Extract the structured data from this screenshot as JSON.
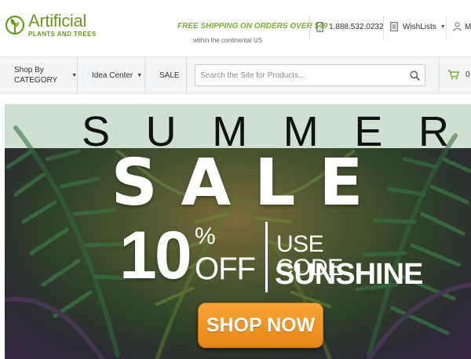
{
  "header": {
    "logo": {
      "title": "Artificial",
      "subtitle": "PLANTS AND TREES"
    },
    "shipping": {
      "main": "FREE SHIPPING ON ORDERS OVER $49",
      "sub": "within the continental US"
    },
    "phone": "1.888.532.0232",
    "wishlists": "WishLists",
    "account": "M"
  },
  "nav": {
    "shop_by": "Shop By",
    "category": "CATEGORY",
    "idea_center": "Idea Center",
    "sale": "SALE",
    "search_placeholder": "Search the Site for Products...",
    "cart_count": "0"
  },
  "hero": {
    "summer": [
      "S",
      "U",
      "M",
      "M",
      "E",
      "R"
    ],
    "sale": "SALE",
    "discount": "10",
    "percent": "%",
    "off": "OFF",
    "use_code": "USE CODE:",
    "code": "SUNSHINE",
    "cta": "SHOP NOW"
  },
  "colors": {
    "brand_green": "#6a9a22",
    "shipping_green": "#7bb031",
    "cart_green": "#7ab02c",
    "cta_orange": "#ef951f"
  },
  "icons": {
    "logo": "leaf-logo-icon",
    "phone": "phone-icon",
    "wishlist": "document-icon",
    "account": "user-icon",
    "search": "search-icon",
    "cart": "cart-icon"
  }
}
